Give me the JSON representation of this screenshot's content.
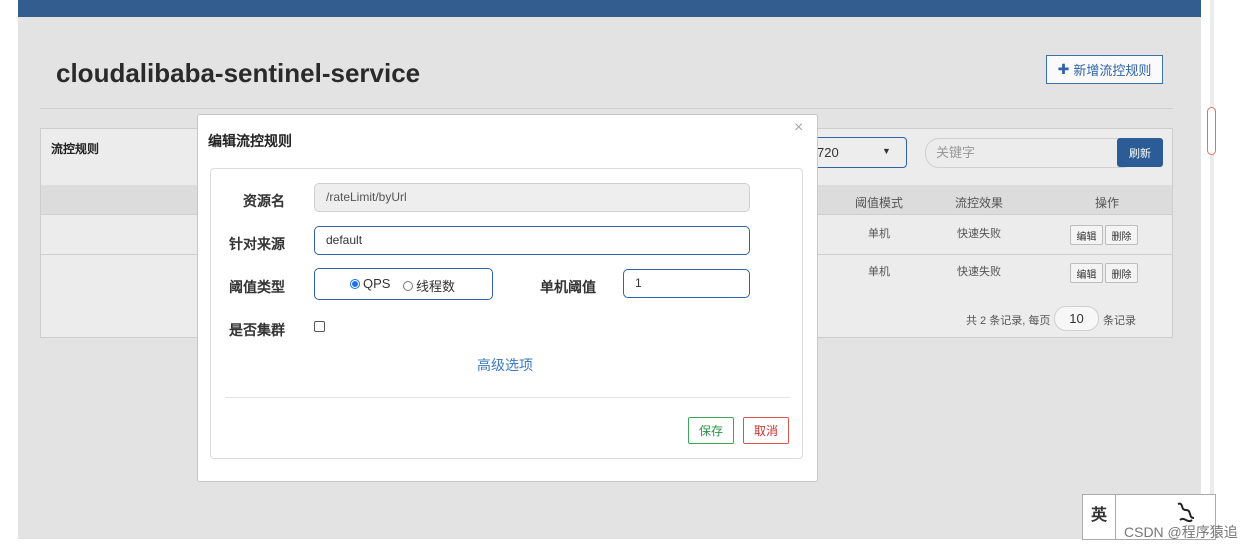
{
  "page": {
    "title": "cloudalibaba-sentinel-service",
    "add_button_label": "新增流控规则"
  },
  "panel": {
    "title": "流控规则",
    "app_select_value": "720",
    "search_placeholder": "关键字",
    "refresh_label": "刷新",
    "columns": [
      "阈值模式",
      "流控效果",
      "操作"
    ],
    "rows": [
      {
        "mode": "单机",
        "effect": "快速失败",
        "edit": "编辑",
        "delete": "删除"
      },
      {
        "mode": "单机",
        "effect": "快速失败",
        "edit": "编辑",
        "delete": "删除"
      }
    ],
    "pager": {
      "prefix": "共 2 条记录, 每页",
      "page_size": "10",
      "suffix": "条记录"
    }
  },
  "modal": {
    "title": "编辑流控规则",
    "close": "×",
    "resource_label": "资源名",
    "resource_value": "/rateLimit/byUrl",
    "origin_label": "针对来源",
    "origin_value": "default",
    "threshold_type_label": "阈值类型",
    "option_qps": "QPS",
    "option_threads": "线程数",
    "selected_option": "QPS",
    "single_threshold_label": "单机阈值",
    "single_threshold_value": "1",
    "cluster_label": "是否集群",
    "cluster_checked": false,
    "advanced_link": "高级选项",
    "save_label": "保存",
    "cancel_label": "取消"
  },
  "overlay": {
    "ime_char": "英",
    "watermark": "CSDN @程序猿追"
  },
  "colors": {
    "topbar": "#335d8e",
    "primary": "#2f62a8",
    "save": "#3aa55b",
    "cancel": "#d9534f",
    "link": "#3b78c2"
  }
}
